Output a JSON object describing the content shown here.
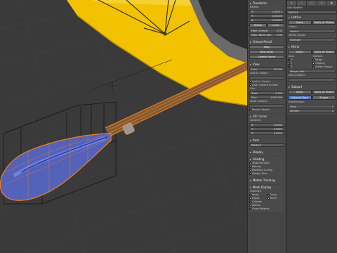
{
  "npanel": {
    "transform": "Transform",
    "radius_label": "Radius:",
    "radius": [
      {
        "axis": "X:",
        "value": "0.00013"
      },
      {
        "axis": "Y:",
        "value": "0.00000"
      },
      {
        "axis": "Z:",
        "value": "0.00000"
      }
    ],
    "global": "Global",
    "local": "Local",
    "mean_crease": "Mean Crease:",
    "mean_crease_val": "0.00",
    "mean_bevel": "Mean Bevel Wei:",
    "mean_bevel_val": "0.00",
    "grease_pencil": "Grease Pencil",
    "new": "New",
    "new_layer": "New Layer",
    "delete_frame": "Delete Frame",
    "view": "View",
    "lens_label": "Lens:",
    "lens_val": "35.000",
    "lock_to_object": "Lock to Object:",
    "lock_to_cursor": "Lock to Cursor",
    "lock_camera": "Lock Camera to View",
    "clip": "Clip:",
    "start_label": "Start:",
    "start_val": "0.100",
    "end_label": "End:",
    "end_val": "1000.000",
    "local_camera": "Local Camera:",
    "render_border": "Render Border",
    "cursor_3d": "3D Cursor",
    "location": "Location:",
    "cursor": [
      {
        "axis": "X:",
        "value": "0.0000"
      },
      {
        "axis": "Y:",
        "value": "0.0000"
      },
      {
        "axis": "Z:",
        "value": "0.0000"
      }
    ],
    "item": "Item",
    "item_name": "PADDLE",
    "display": "Display",
    "shading": "Shading",
    "textured_solid": "Textured Solid",
    "matcap": "Matcap",
    "backface": "Backface Culling",
    "hidden_wire": "Hidden Wire",
    "motion_tracking": "Motion Tracking",
    "mesh_display": "Mesh Display",
    "overlays": "Overlays:",
    "faces": "Faces",
    "sharp": "Sharp",
    "edges": "Edges",
    "bevel": "Bevel",
    "creases": "Creases",
    "seams": "Seams",
    "show_weights": "Show Weights"
  },
  "props": {
    "add_modifier": "Add Modifier",
    "paddle": "PADDLE",
    "mod1_name": "Lattice",
    "apply": "Apply",
    "apply_as_shape": "Apply as Shape",
    "object_label": "Object:",
    "object_val": "Lattice",
    "vertex_group": "Vertex Group:",
    "strength": "Strength",
    "mod2_name": "Mirror",
    "axis": "Axis:",
    "options": "Options:",
    "ax": [
      "X",
      "Y",
      "Z"
    ],
    "opt": [
      "Merge",
      "Clipping",
      "Vertex Groups"
    ],
    "merge_limit": "Merge Limit",
    "mirror_object": "Mirror Object:",
    "mod3_name": "Subsurf",
    "catmull": "Catmull-Clark",
    "simple": "Simple",
    "subdivisions": "Subdivisions:",
    "view_label": "View:",
    "render_label": "Render:",
    "view_val": "2",
    "render_val": "2"
  }
}
